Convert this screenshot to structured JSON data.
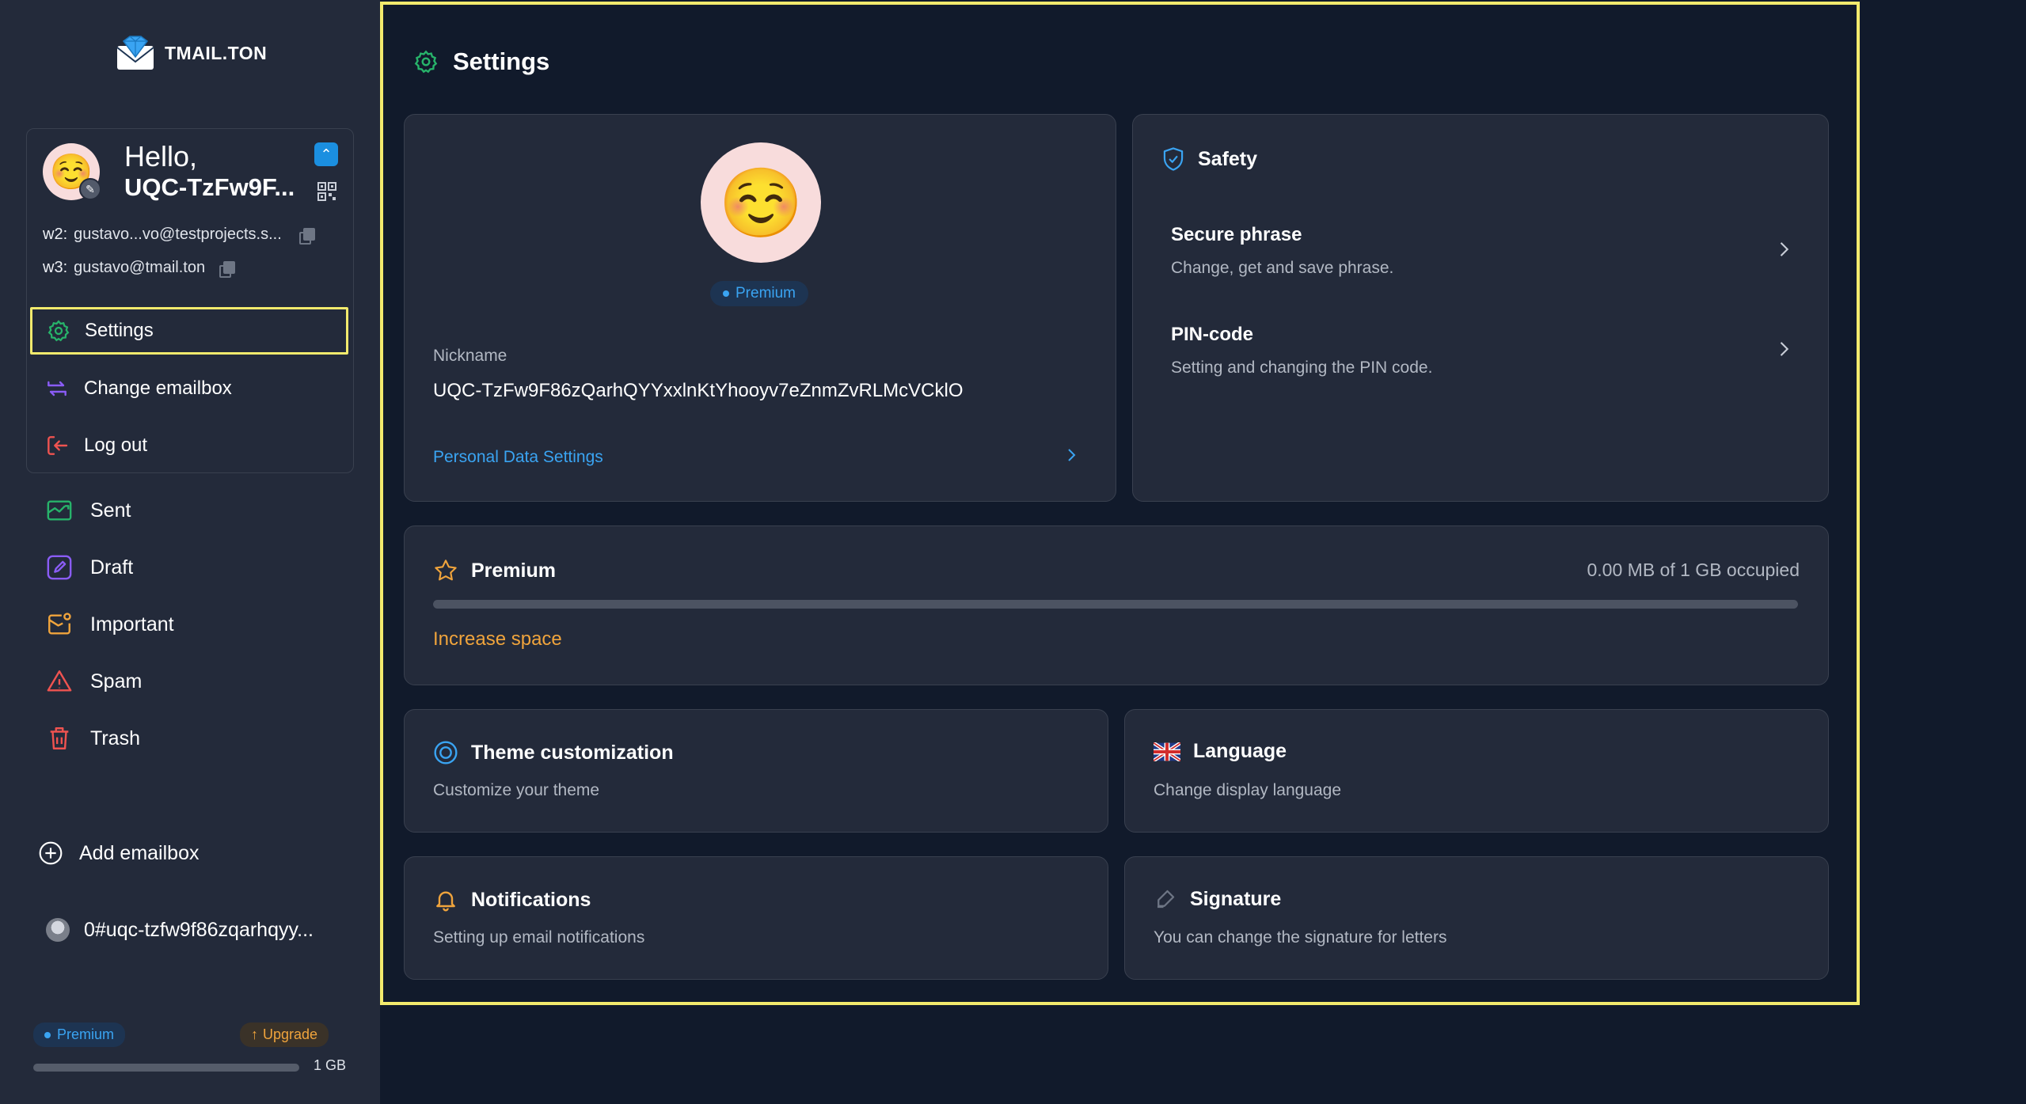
{
  "app": {
    "logo_text": "TMAIL.TON"
  },
  "account": {
    "hello": "Hello,",
    "name": "UQC-TzFw9F...",
    "addresses": [
      {
        "key": "w2:",
        "value": "gustavo...vo@testprojects.s..."
      },
      {
        "key": "w3:",
        "value": "gustavo@tmail.ton"
      }
    ],
    "menu": [
      {
        "label": "Settings",
        "icon": "gear-icon"
      },
      {
        "label": "Change emailbox",
        "icon": "swap-icon"
      },
      {
        "label": "Log out",
        "icon": "logout-icon"
      }
    ]
  },
  "nav": [
    {
      "label": "Sent",
      "icon": "sent-icon",
      "color": "#27b36a"
    },
    {
      "label": "Draft",
      "icon": "pencil-icon",
      "color": "#8a5cf6"
    },
    {
      "label": "Important",
      "icon": "important-icon",
      "color": "#f0a43c"
    },
    {
      "label": "Spam",
      "icon": "warning-icon",
      "color": "#ef5350"
    },
    {
      "label": "Trash",
      "icon": "trash-icon",
      "color": "#ef5350"
    }
  ],
  "add_emailbox": "Add emailbox",
  "wallet": "0#uqc-tzfw9f86zqarhqyy...",
  "sidebar_footer": {
    "premium": "Premium",
    "upgrade": "Upgrade",
    "storage": "1 GB",
    "storage_fraction": 0.0
  },
  "page": {
    "title": "Settings"
  },
  "profile": {
    "badge": "Premium",
    "nickname_label": "Nickname",
    "nickname": "UQC-TzFw9F86zQarhQYYxxlnKtYhooyv7eZnmZvRLMcVCklO",
    "personal_link": "Personal Data Settings"
  },
  "safety": {
    "title": "Safety",
    "items": [
      {
        "title": "Secure phrase",
        "sub": "Change, get and save phrase."
      },
      {
        "title": "PIN-code",
        "sub": "Setting and changing the PIN code."
      }
    ]
  },
  "premium": {
    "title": "Premium",
    "usage": "0.00 MB of 1 GB occupied",
    "used_fraction": 0.0,
    "increase": "Increase space"
  },
  "settings_cards": [
    {
      "title": "Theme customization",
      "sub": "Customize your theme",
      "icon": "theme-icon"
    },
    {
      "title": "Language",
      "sub": "Change display language",
      "icon": "uk-flag-icon"
    },
    {
      "title": "Notifications",
      "sub": "Setting up email notifications",
      "icon": "bell-icon"
    },
    {
      "title": "Signature",
      "sub": "You can change the signature for letters",
      "icon": "signature-icon"
    }
  ],
  "colors": {
    "accent": "#3aa4f2",
    "warning": "#f0a43c",
    "highlight": "#f2ea6d",
    "background": "#111a2b",
    "panel": "#232a3a"
  }
}
